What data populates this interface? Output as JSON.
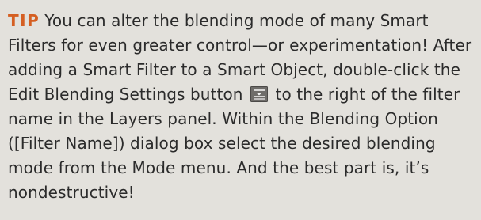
{
  "tip": {
    "label": "TIP",
    "text_part1": "You can alter the blending mode of many Smart Filters for even greater control—or experimentation! After adding a Smart Filter to a Smart Object, double-click the Edit Blending Settings button",
    "icon": "edit-blending-settings-icon",
    "text_part2": "to the right of the filter name in the Layers panel. Within the Blending Option ([Filter Name]) dialog box select the desired blending mode from the Mode menu. And the best part is, it’s nondestructive!"
  },
  "colors": {
    "background": "#e3e1dc",
    "label": "#d55f22",
    "text": "#2b2b2b"
  }
}
